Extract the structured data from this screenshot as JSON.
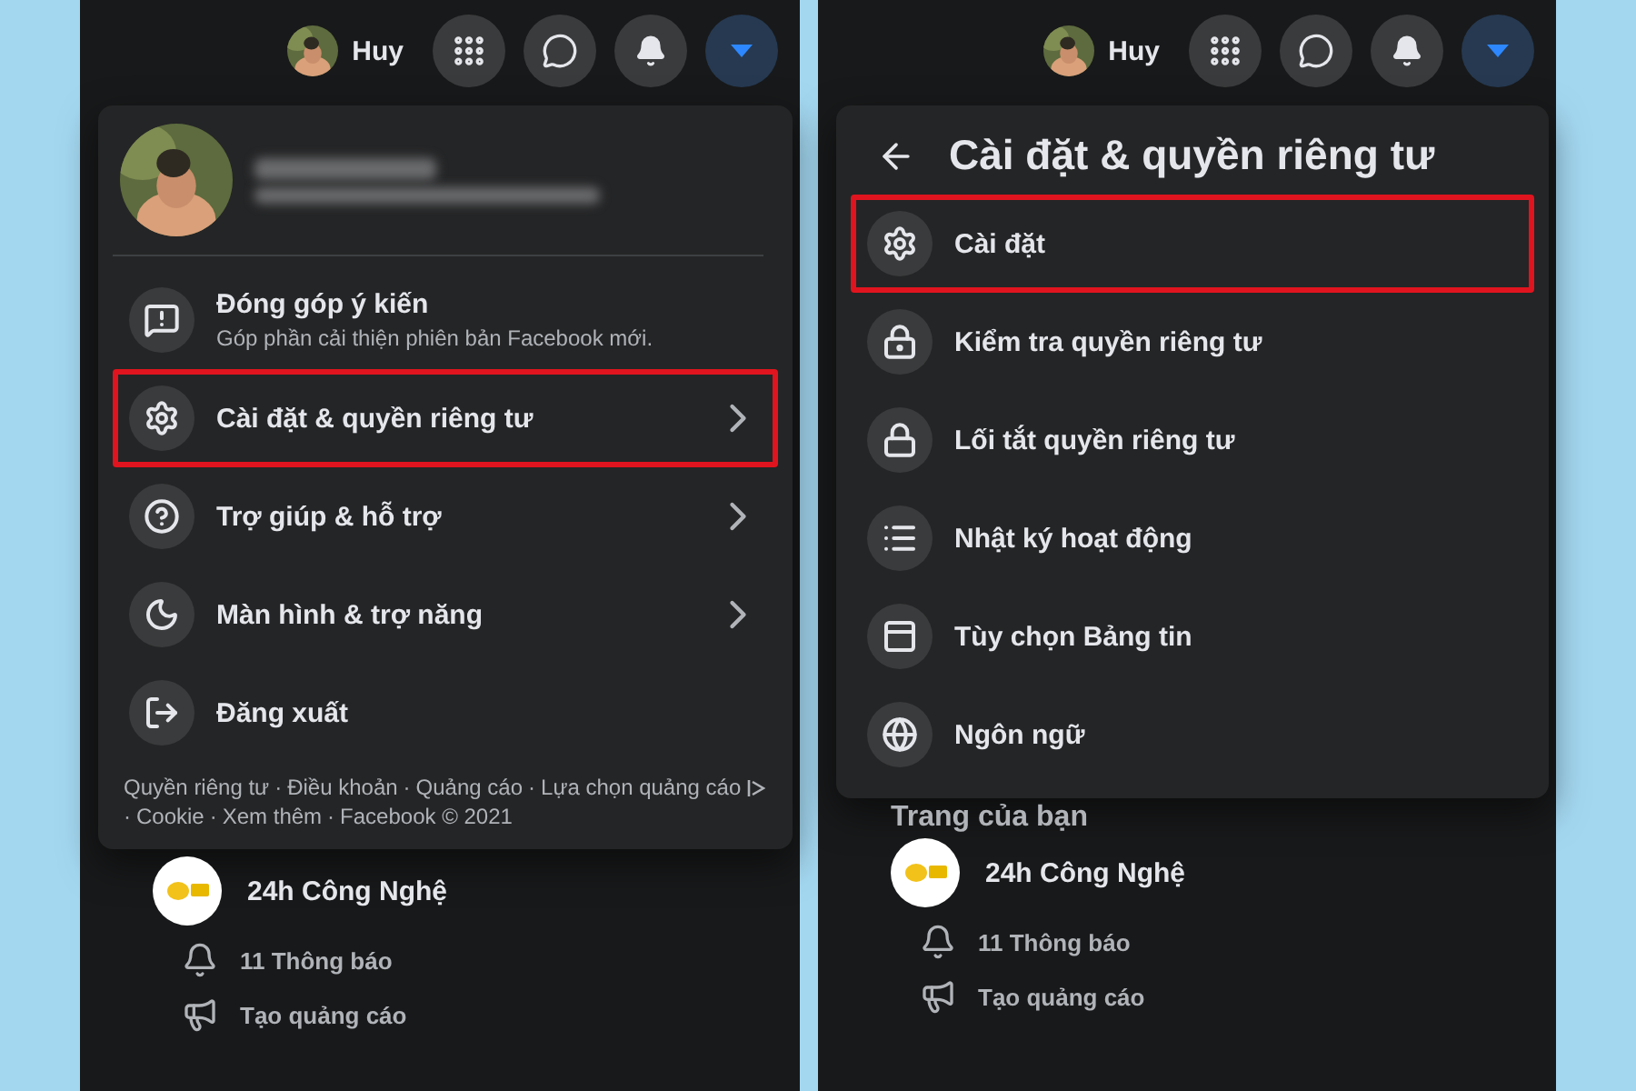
{
  "panels": [
    {
      "top_bar": {
        "user": "Huy"
      },
      "menu": {
        "kind": "main",
        "profile": true,
        "items": [
          {
            "label": "Đóng góp ý kiến",
            "subtitle": "Góp phần cải thiện phiên bản Facebook mới.",
            "highlighted": false,
            "has_submenu": false
          },
          {
            "label": "Cài đặt & quyền riêng tư",
            "highlighted": true,
            "has_submenu": true
          },
          {
            "label": "Trợ giúp & hỗ trợ",
            "highlighted": false,
            "has_submenu": true
          },
          {
            "label": "Màn hình & trợ năng",
            "highlighted": false,
            "has_submenu": true
          },
          {
            "label": "Đăng xuất",
            "highlighted": false,
            "has_submenu": false
          }
        ],
        "separator": "·",
        "footer": [
          {
            "label": "Quyền riêng tư"
          },
          {
            "label": "Điều khoản"
          },
          {
            "label": "Quảng cáo"
          },
          {
            "label": "Lựa chọn quảng cáo",
            "ad_choices": true
          },
          {
            "label": "Cookie"
          },
          {
            "label": "Xem thêm"
          },
          {
            "label": "Facebook © 2021"
          }
        ]
      },
      "pages": {
        "page_name": "24h Công Nghệ",
        "links": [
          "11 Thông báo",
          "Tạo quảng cáo"
        ]
      }
    },
    {
      "top_bar": {
        "user": "Huy"
      },
      "menu": {
        "kind": "settings",
        "title": "Cài đặt & quyền riêng tư",
        "items": [
          {
            "label": "Cài đặt",
            "highlighted": true,
            "has_submenu": false
          },
          {
            "label": "Kiểm tra quyền riêng tư",
            "highlighted": false,
            "has_submenu": false
          },
          {
            "label": "Lối tắt quyền riêng tư",
            "highlighted": false,
            "has_submenu": false
          },
          {
            "label": "Nhật ký hoạt động",
            "highlighted": false,
            "has_submenu": false
          },
          {
            "label": "Tùy chọn Bảng tin",
            "highlighted": false,
            "has_submenu": false
          },
          {
            "label": "Ngôn ngữ",
            "highlighted": false,
            "has_submenu": false
          }
        ]
      },
      "pages": {
        "heading": "Trang của bạn",
        "page_name": "24h Công Nghệ",
        "links": [
          "11 Thông báo",
          "Tạo quảng cáo"
        ]
      }
    }
  ]
}
